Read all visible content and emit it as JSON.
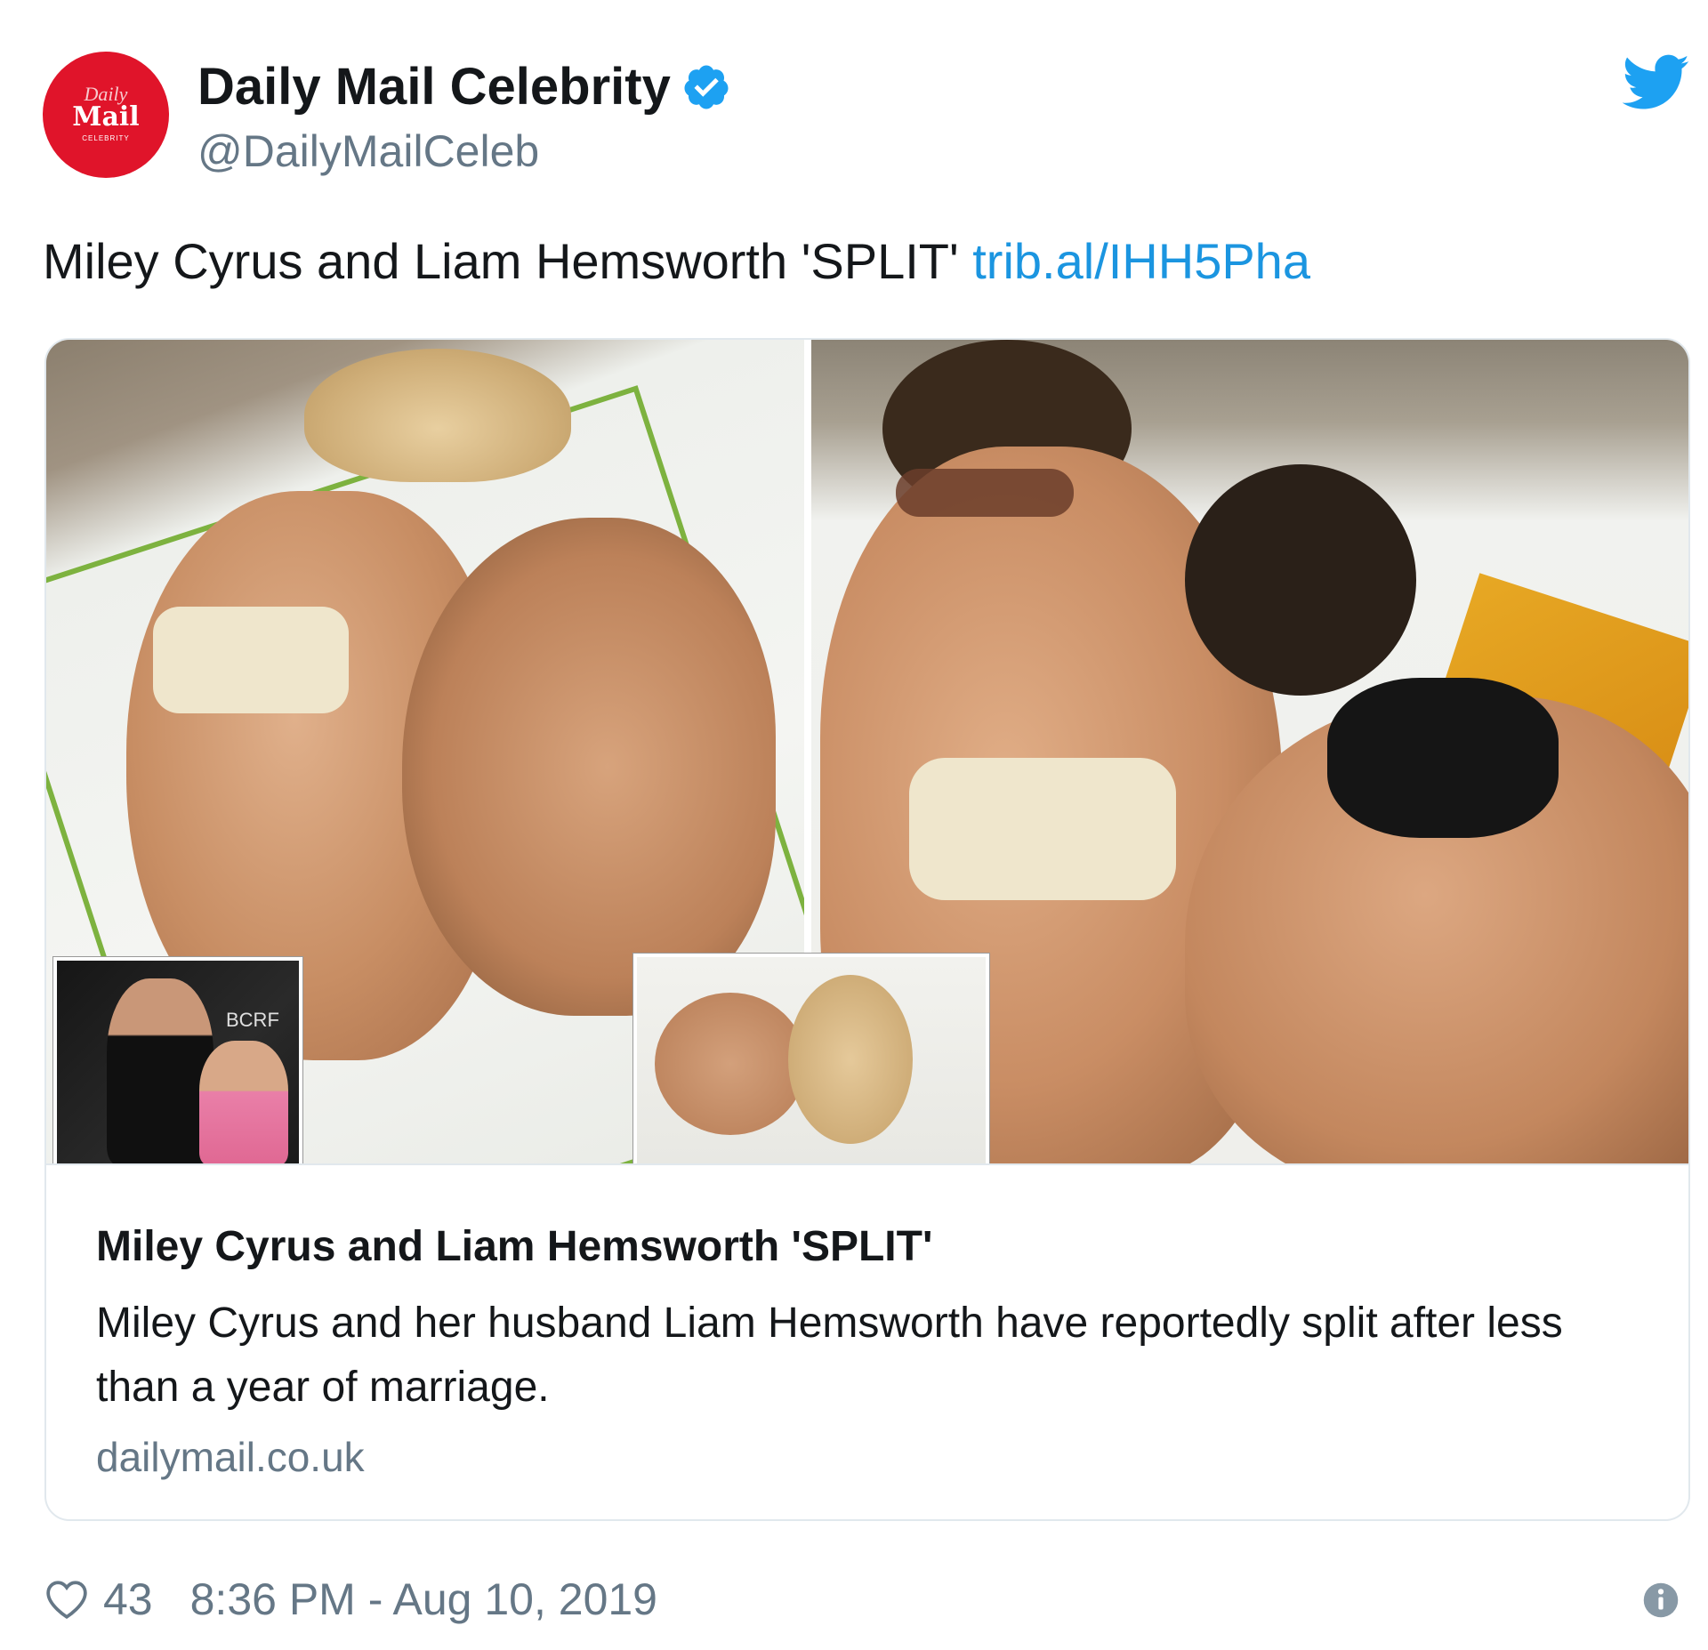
{
  "author": {
    "avatar_text": {
      "line1": "Daily",
      "line2": "Mail",
      "line3": "CELEBRITY"
    },
    "display_name": "Daily Mail Celebrity",
    "handle": "@DailyMailCeleb",
    "verified": true
  },
  "tweet": {
    "text": "Miley Cyrus and Liam Hemsworth 'SPLIT'",
    "link_text": "trib.al/IHH5Pha"
  },
  "card": {
    "inset_backdrop_text": "BCRF",
    "title": "Miley Cyrus and Liam Hemsworth 'SPLIT'",
    "description": "Miley Cyrus and her husband Liam Hemsworth have reportedly split after less than a year of marriage.",
    "domain": "dailymail.co.uk"
  },
  "footer": {
    "likes": "43",
    "timestamp": "8:36 PM - Aug 10, 2019"
  },
  "icons": {
    "platform": "twitter-bird-icon",
    "verified": "verified-badge-icon",
    "like": "heart-icon",
    "info": "info-icon"
  },
  "colors": {
    "brand_blue": "#1da1f2",
    "link_blue": "#1b95e0",
    "daily_mail_red": "#e0142a",
    "secondary_text": "#657786",
    "border": "#e1e8ed"
  }
}
